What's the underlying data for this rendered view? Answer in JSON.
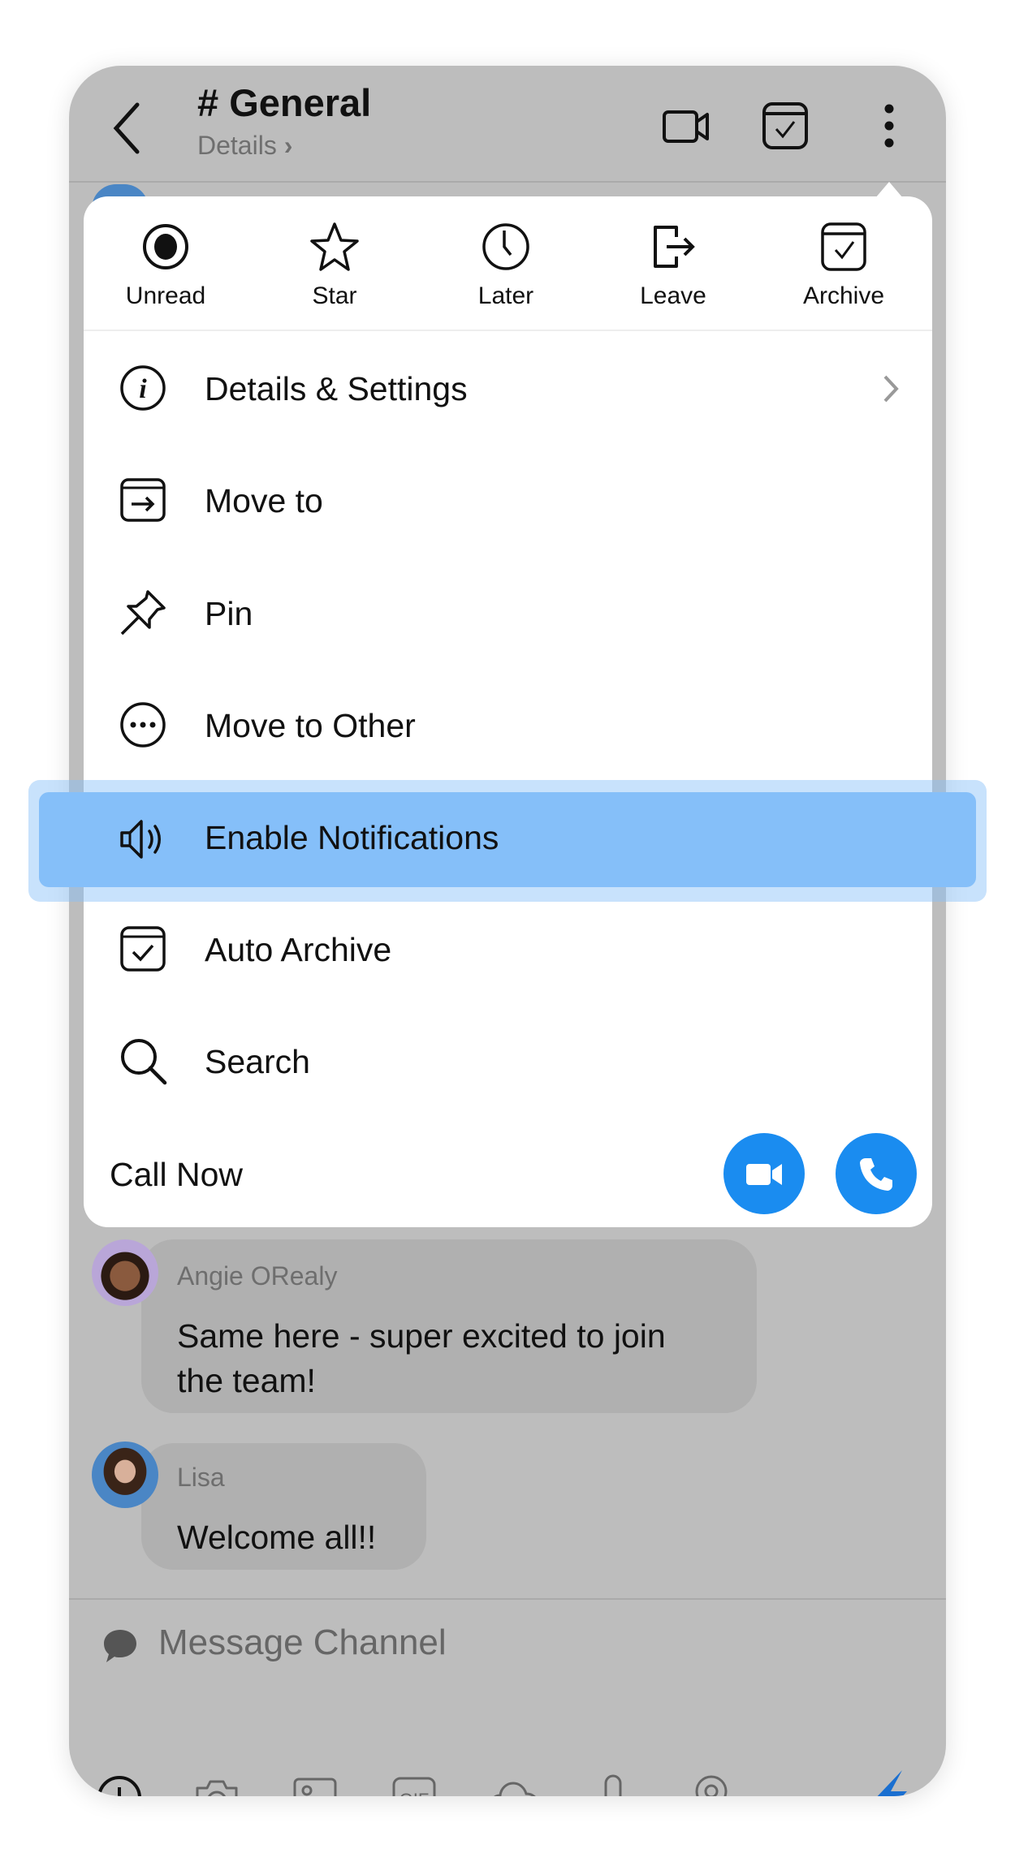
{
  "header": {
    "title": "# General",
    "subtitle": "Details",
    "icons": [
      "back-chevron-icon",
      "video-camera-icon",
      "archive-check-icon",
      "more-vertical-icon"
    ]
  },
  "quick_actions": [
    {
      "label": "Unread",
      "icon": "eye-icon"
    },
    {
      "label": "Star",
      "icon": "star-icon"
    },
    {
      "label": "Later",
      "icon": "clock-icon"
    },
    {
      "label": "Leave",
      "icon": "leave-icon"
    },
    {
      "label": "Archive",
      "icon": "archive-icon"
    }
  ],
  "menu_items": [
    {
      "label": "Details & Settings",
      "icon": "info-icon"
    },
    {
      "label": "Move to",
      "icon": "move-to-icon"
    },
    {
      "label": "Pin",
      "icon": "pin-icon"
    },
    {
      "label": "Move to Other",
      "icon": "more-circle-icon"
    },
    {
      "label": "Enable Notifications",
      "icon": "speaker-icon",
      "highlighted": true
    },
    {
      "label": "Auto Archive",
      "icon": "archive-check-icon"
    },
    {
      "label": "Search",
      "icon": "search-icon"
    }
  ],
  "call": {
    "label": "Call Now",
    "accent": "#1a8cf0"
  },
  "messages": [
    {
      "author": "Angie ORealy",
      "lines": [
        "Same here - super excited to join",
        "the team!"
      ]
    },
    {
      "author": "Lisa",
      "lines": [
        "Welcome all!!"
      ]
    }
  ],
  "composer": {
    "placeholder": "Message Channel",
    "toolbar": [
      "plus-icon",
      "camera-icon",
      "image-icon",
      "gif-icon",
      "cloud-icon",
      "microphone-icon",
      "location-icon",
      "lightning-icon"
    ]
  },
  "colors": {
    "highlight": "#85bff9",
    "overlay": "#bdbdbd",
    "accent": "#1a8cf0"
  }
}
